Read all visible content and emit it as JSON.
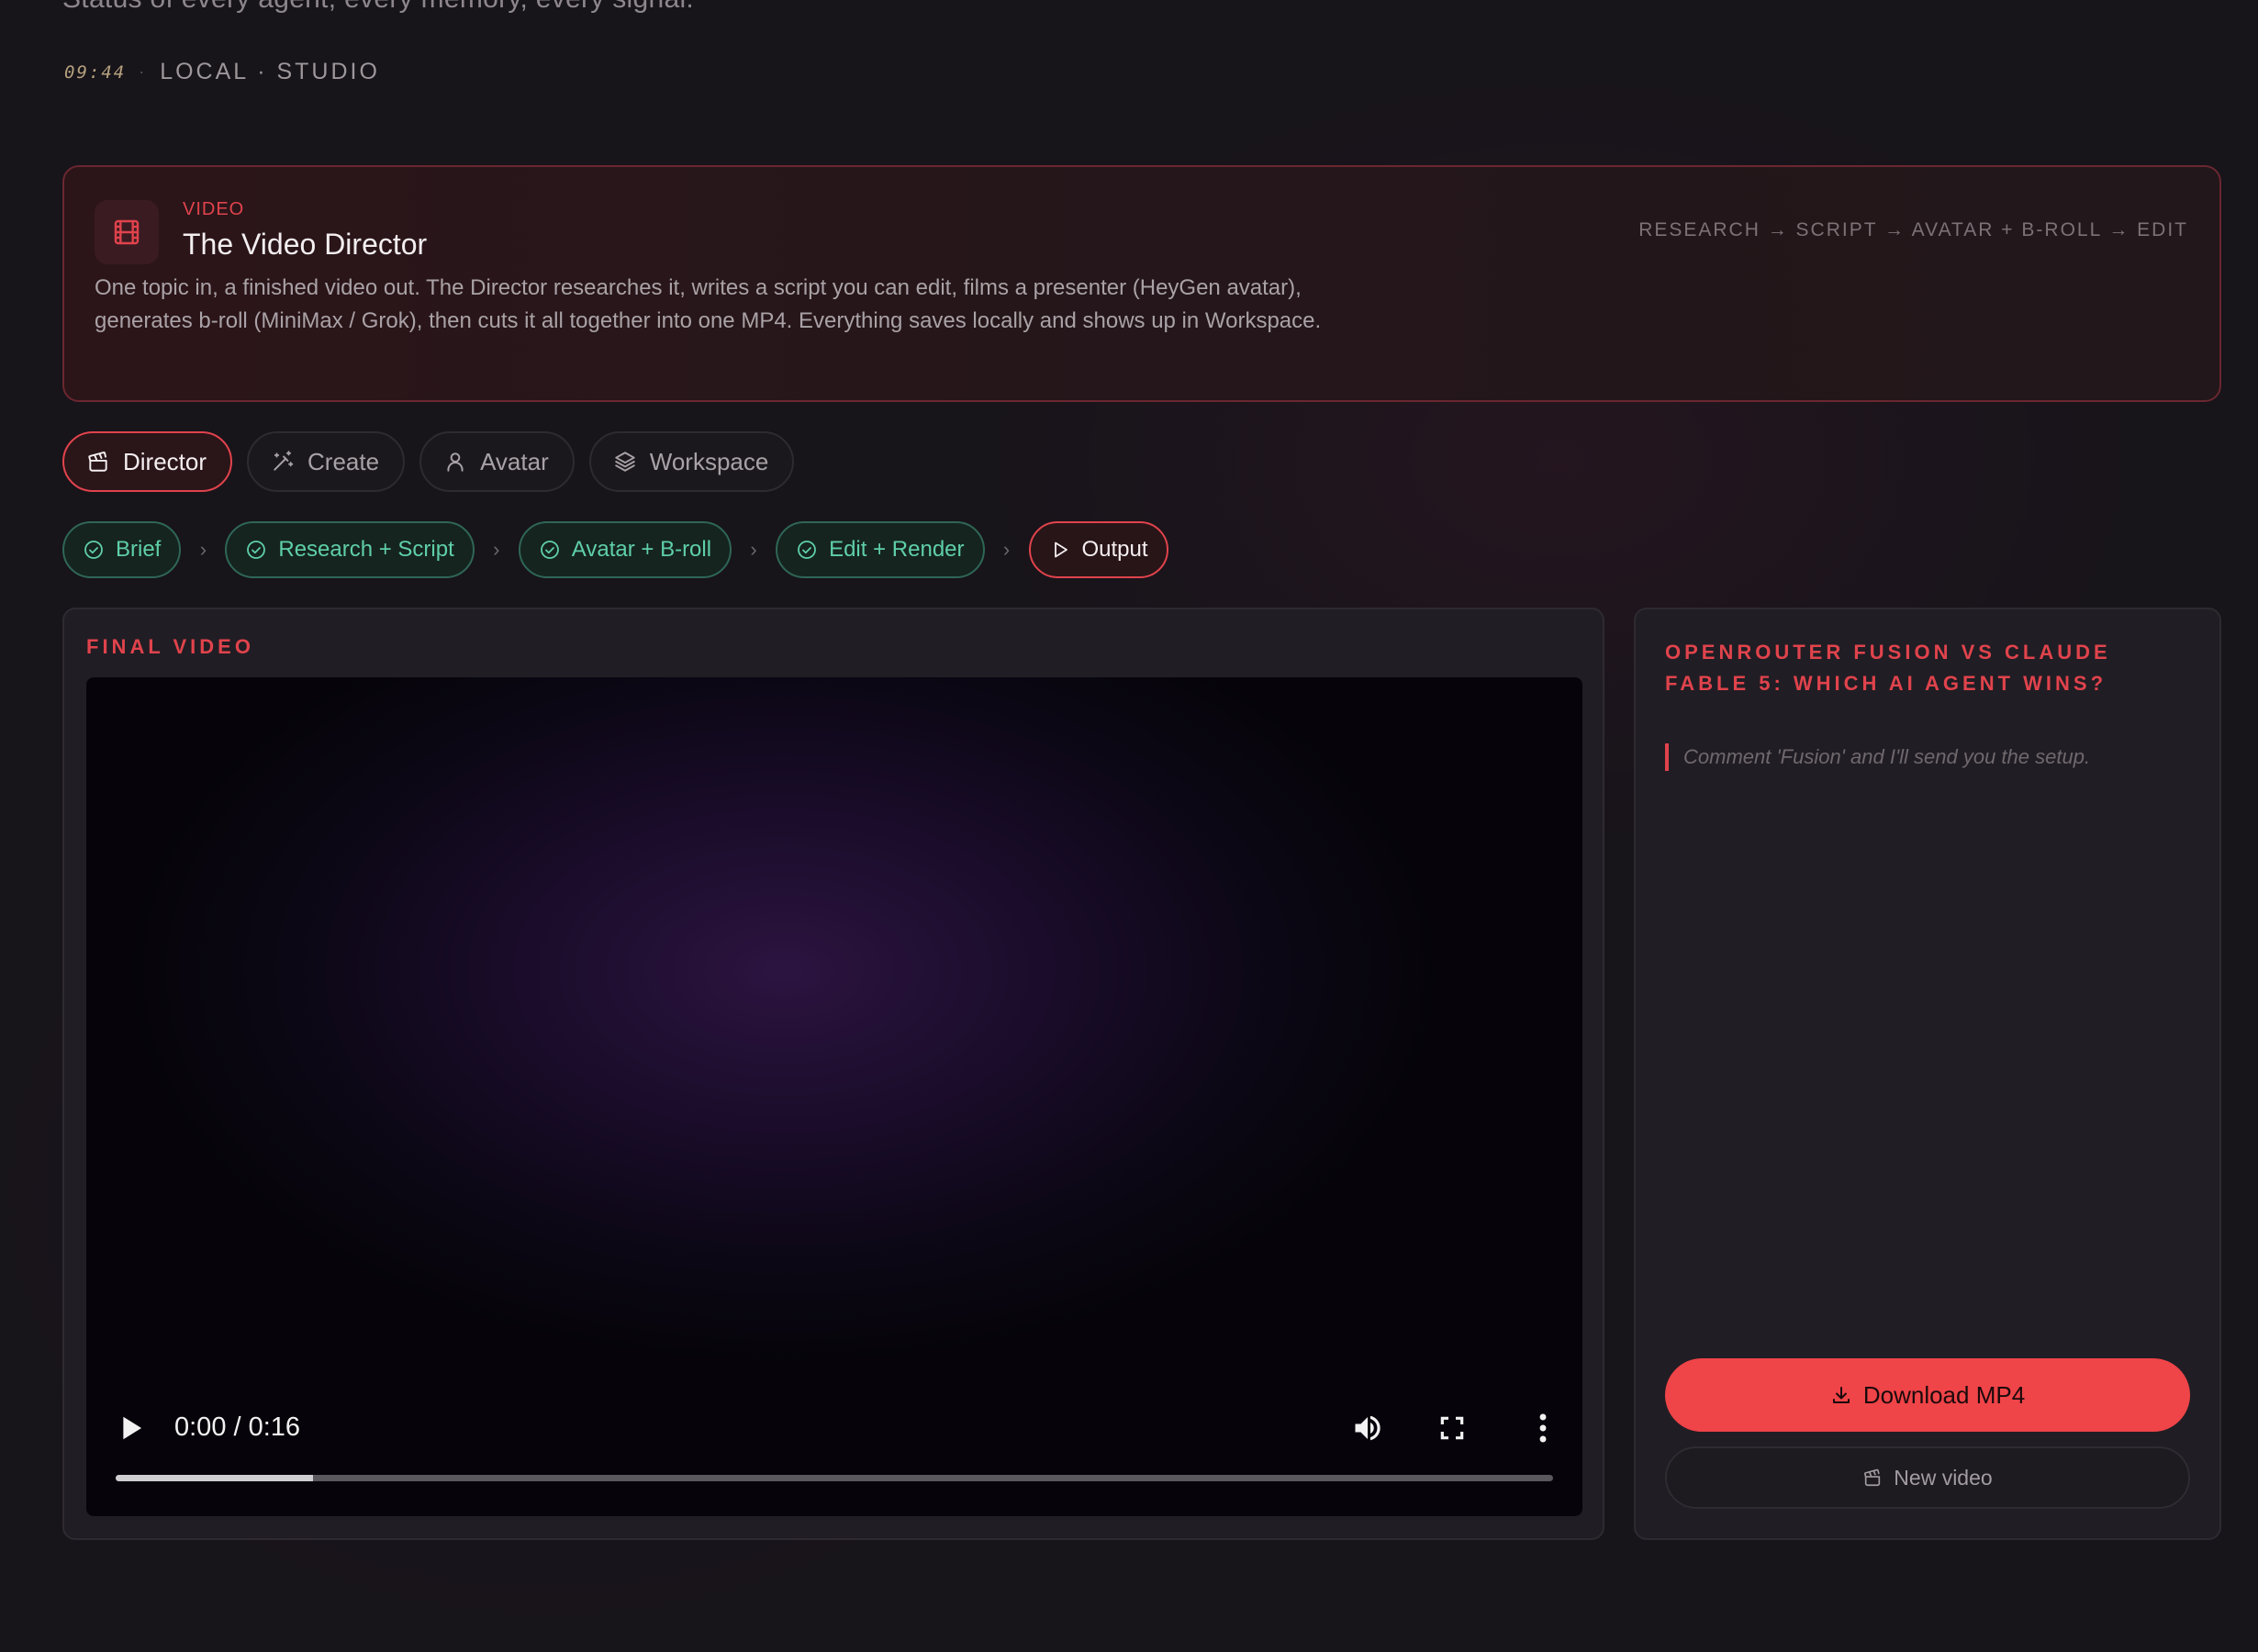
{
  "header": {
    "subtitle": "Status of every agent, every memory, every signal.",
    "clock": "09:44",
    "separator": "·",
    "location": "LOCAL · STUDIO"
  },
  "hero": {
    "icon": "film-icon",
    "kicker": "VIDEO",
    "title": "The Video Director",
    "description": "One topic in, a finished video out. The Director researches it, writes a script you can edit, films a presenter (HeyGen avatar), generates b-roll (MiniMax / Grok), then cuts it all together into one MP4. Everything saves locally and shows up in Workspace.",
    "flow": "RESEARCH → SCRIPT → AVATAR + B-ROLL → EDIT"
  },
  "tabs": [
    {
      "label": "Director",
      "icon": "clapperboard-icon",
      "active": true
    },
    {
      "label": "Create",
      "icon": "magic-wand-icon",
      "active": false
    },
    {
      "label": "Avatar",
      "icon": "user-icon",
      "active": false
    },
    {
      "label": "Workspace",
      "icon": "layers-icon",
      "active": false
    }
  ],
  "steps": [
    {
      "label": "Brief",
      "status": "done"
    },
    {
      "label": "Research + Script",
      "status": "done"
    },
    {
      "label": "Avatar + B-roll",
      "status": "done"
    },
    {
      "label": "Edit + Render",
      "status": "done"
    },
    {
      "label": "Output",
      "status": "current"
    }
  ],
  "video": {
    "label": "FINAL VIDEO",
    "time": "0:00 / 0:16",
    "buffered_fraction": 0.137
  },
  "side": {
    "title": "OPENROUTER FUSION VS CLAUDE FABLE 5: WHICH AI AGENT WINS?",
    "quote": "Comment 'Fusion' and I'll send you the setup.",
    "download_label": "Download MP4",
    "new_label": "New video"
  },
  "colors": {
    "accent": "#e0434c",
    "success": "#5fcfa8",
    "download": "#ef4448"
  }
}
